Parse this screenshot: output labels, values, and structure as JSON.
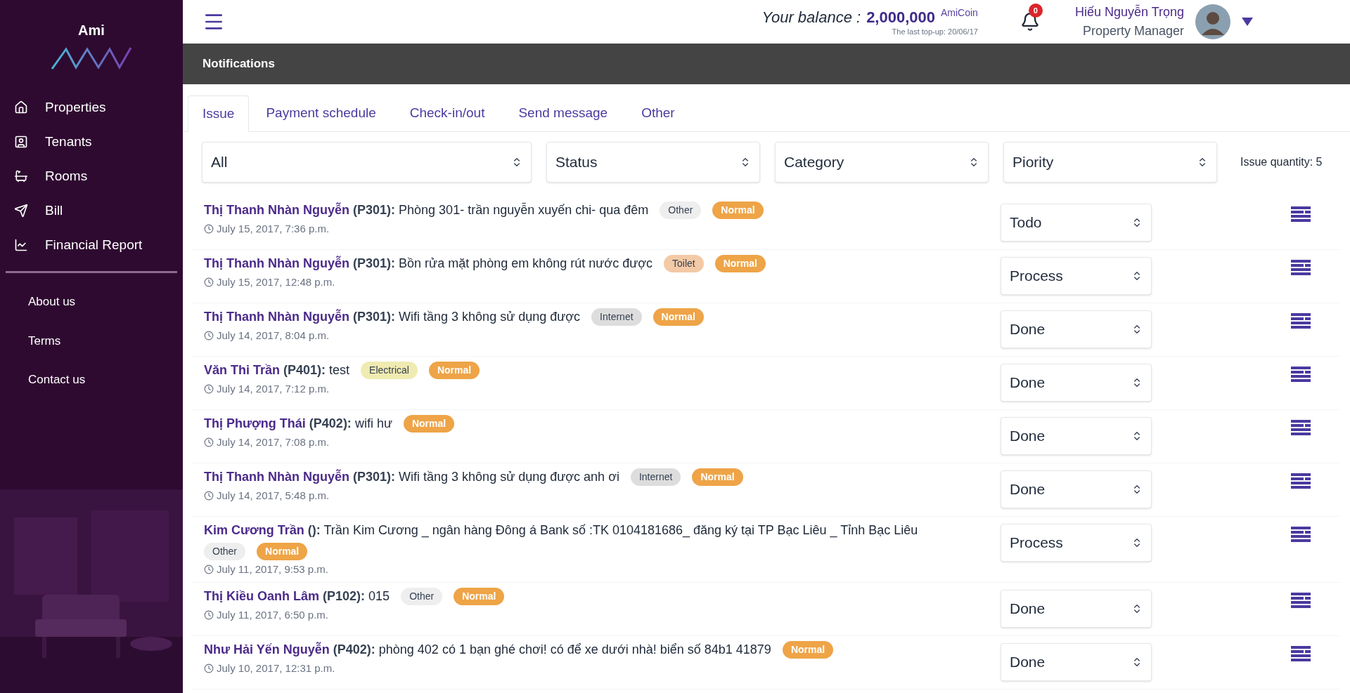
{
  "sidebar": {
    "logo": "Ami",
    "nav": [
      {
        "label": "Properties"
      },
      {
        "label": "Tenants"
      },
      {
        "label": "Rooms"
      },
      {
        "label": "Bill"
      },
      {
        "label": "Financial Report"
      }
    ],
    "links": [
      "About us",
      "Terms",
      "Contact us"
    ]
  },
  "header": {
    "balance_label": "Your balance :",
    "balance": "2,000,000",
    "currency": "AmiCoin",
    "last_topup": "The last top-up: 20/06/17",
    "notifications": "0",
    "user_name": "Hiếu Nguyễn Trọng",
    "user_role": "Property Manager"
  },
  "title": "Notifications",
  "tabs": [
    {
      "label": "Issue",
      "selected": true
    },
    {
      "label": "Payment schedule",
      "selected": false
    },
    {
      "label": "Check-in/out",
      "selected": false
    },
    {
      "label": "Send message",
      "selected": false
    },
    {
      "label": "Other",
      "selected": false
    }
  ],
  "filters": [
    "All",
    "Status",
    "Category",
    "Piority"
  ],
  "issue_quantity": "Issue quantity: 5",
  "issues": [
    {
      "tenant": "Thị Thanh Nhàn Nguyễn",
      "room": "(P301):",
      "text": "Phòng 301- trần nguyễn xuyến chi- qua đêm",
      "tags": [
        {
          "label": "Other",
          "color": "#eeeeee"
        }
      ],
      "priority": "Normal",
      "time": "July 15, 2017, 7:36 p.m.",
      "status": "Todo"
    },
    {
      "tenant": "Thị Thanh Nhàn Nguyễn",
      "room": "(P301):",
      "text": "Bồn rửa mặt phòng em không rút nước được",
      "tags": [
        {
          "label": "Toilet",
          "color": "#f3c9a6"
        }
      ],
      "priority": "Normal",
      "time": "July 15, 2017, 12:48 p.m.",
      "status": "Process"
    },
    {
      "tenant": "Thị Thanh Nhàn Nguyễn",
      "room": "(P301):",
      "text": "Wifi tầng 3 không sử dụng được",
      "tags": [
        {
          "label": "Internet",
          "color": "#dddddd"
        }
      ],
      "priority": "Normal",
      "time": "July 14, 2017, 8:04 p.m.",
      "status": "Done"
    },
    {
      "tenant": "Văn Thi Trần",
      "room": "(P401):",
      "text": "test",
      "tags": [
        {
          "label": "Electrical",
          "color": "#f0ebb0"
        }
      ],
      "priority": "Normal",
      "time": "July 14, 2017, 7:12 p.m.",
      "status": "Done"
    },
    {
      "tenant": "Thị Phượng Thái",
      "room": "(P402):",
      "text": "wifi hư",
      "priority": "Normal",
      "time": "July 14, 2017, 7:08 p.m.",
      "status": "Done"
    },
    {
      "tenant": "Thị Thanh Nhàn Nguyễn",
      "room": "(P301):",
      "text": "Wifi tầng 3 không sử dụng được anh ơi",
      "tags": [
        {
          "label": "Internet",
          "color": "#dddddd"
        }
      ],
      "priority": "Normal",
      "time": "July 14, 2017, 5:48 p.m.",
      "status": "Done"
    },
    {
      "tenant": "Kim Cương Trần",
      "room": "():",
      "text": "Trần Kim Cương _ ngân hàng Đông á Bank số :TK 0104181686_ đăng ký tại TP Bạc Liêu _ Tỉnh Bạc Liêu",
      "tags": [
        {
          "label": "Other",
          "color": "#eeeeee"
        }
      ],
      "priority": "Normal",
      "time": "July 11, 2017, 9:53 p.m.",
      "status": "Process"
    },
    {
      "tenant": "Thị Kiều Oanh Lâm",
      "room": "(P102):",
      "text": "015",
      "tags": [
        {
          "label": "Other",
          "color": "#eeeeee"
        }
      ],
      "priority": "Normal",
      "time": "July 11, 2017, 6:50 p.m.",
      "status": "Done"
    },
    {
      "tenant": "Như Hải Yến Nguyễn",
      "room": "(P402):",
      "text": "phòng 402 có 1 bạn ghé chơi! có để xe dưới nhà! biển số 84b1 41879",
      "priority": "Normal",
      "time": "July 10, 2017, 12:31 p.m.",
      "status": "Done"
    }
  ]
}
